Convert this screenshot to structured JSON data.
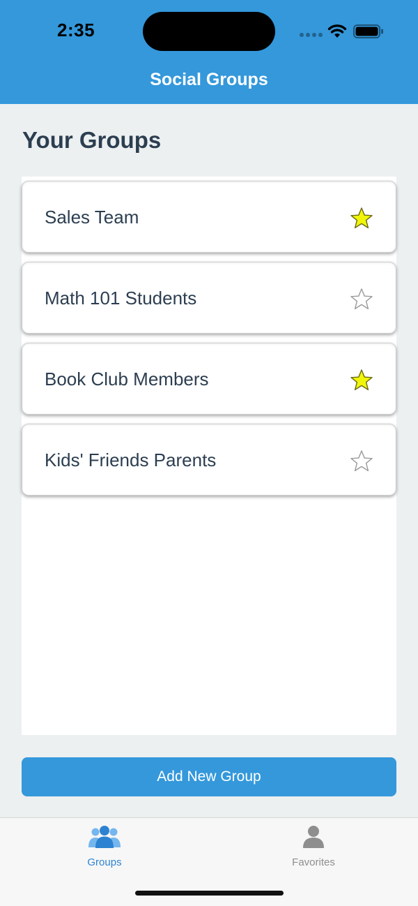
{
  "status_bar": {
    "time": "2:35"
  },
  "header": {
    "title": "Social Groups",
    "background_color": "#3498db"
  },
  "main": {
    "title": "Your Groups",
    "groups": [
      {
        "name": "Sales Team",
        "favorite": true,
        "icon": "star-filled-icon"
      },
      {
        "name": "Math 101 Students",
        "favorite": false,
        "icon": "star-outline-icon"
      },
      {
        "name": "Book Club Members",
        "favorite": true,
        "icon": "star-filled-icon"
      },
      {
        "name": "Kids' Friends Parents",
        "favorite": false,
        "icon": "star-outline-icon"
      }
    ],
    "favorite_star_color": "#f1f50a"
  },
  "actions": {
    "add_group_label": "Add New Group"
  },
  "tab_bar": {
    "tabs": [
      {
        "label": "Groups",
        "icon": "people-group-icon",
        "selected": true
      },
      {
        "label": "Favorites",
        "icon": "person-icon",
        "selected": false
      }
    ],
    "active_color": "#2d83d1",
    "inactive_color": "#8e8e8e"
  }
}
